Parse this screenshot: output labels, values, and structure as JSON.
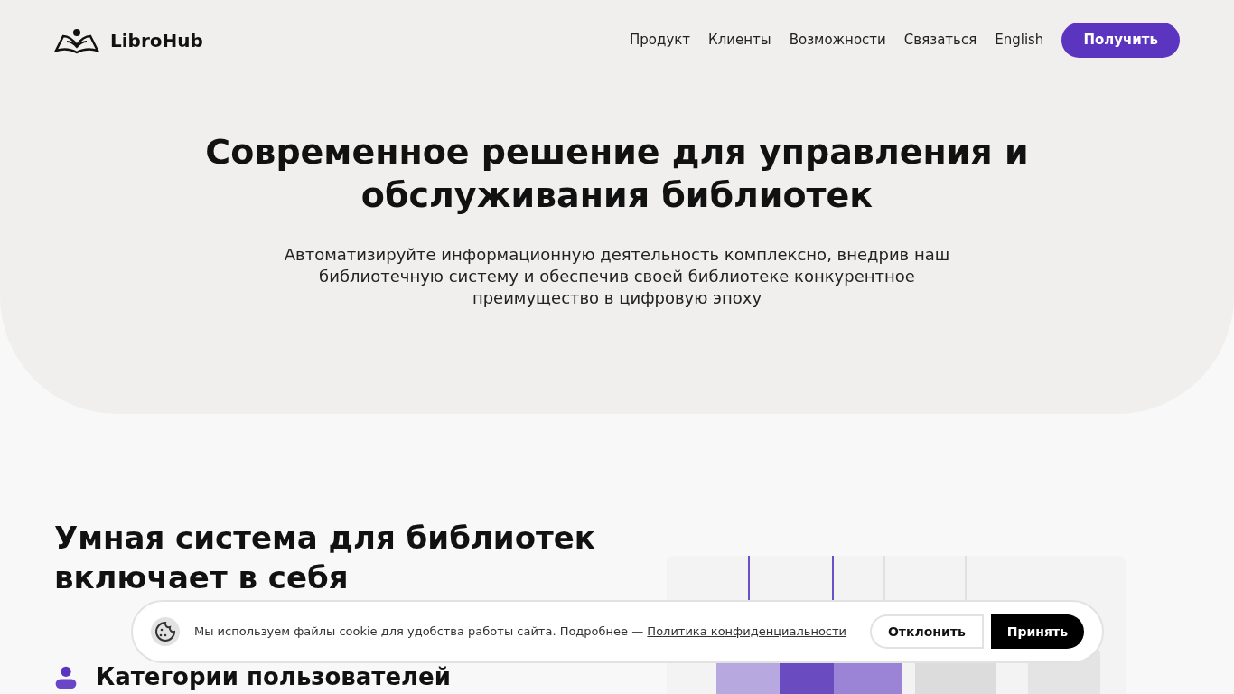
{
  "header": {
    "logo": "LibroHub",
    "nav": [
      {
        "label": "Продукт"
      },
      {
        "label": "Клиенты"
      },
      {
        "label": "Возможности"
      },
      {
        "label": "Связаться"
      },
      {
        "label": "English"
      }
    ],
    "cta": "Получить"
  },
  "hero": {
    "title": "Современное решение для управления и обслуживания библиотек",
    "subtitle": "Автоматизируйте информационную деятельность комплексно, внедрив наш библиотечную систему и обеспечив своей библиотеке конкурентное преимущество в цифровую эпоху"
  },
  "features": {
    "title": "Умная система для библиотек включает в себя",
    "items": [
      {
        "label": "Категории пользователей"
      }
    ]
  },
  "cookie_banner": {
    "text": "Мы используем файлы cookie для удобства работы сайта. Подробнее —",
    "link": "Политика конфиденциальности",
    "buttons": [
      {
        "label": "Отклонить",
        "kind": "outline"
      },
      {
        "label": "Принять",
        "kind": "solid"
      }
    ]
  }
}
